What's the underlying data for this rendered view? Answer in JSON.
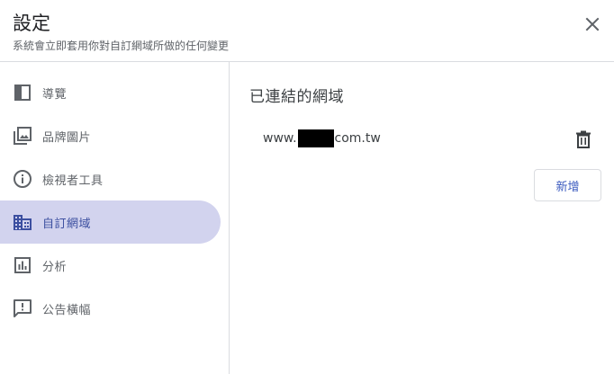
{
  "header": {
    "title": "設定",
    "subtitle": "系統會立即套用你對自訂網域所做的任何變更",
    "close_icon": "close-icon"
  },
  "sidebar": {
    "items": [
      {
        "label": "導覽",
        "icon": "layout-panel-icon",
        "active": false
      },
      {
        "label": "品牌圖片",
        "icon": "image-library-icon",
        "active": false
      },
      {
        "label": "檢視者工具",
        "icon": "info-icon",
        "active": false
      },
      {
        "label": "自訂網域",
        "icon": "domain-icon",
        "active": true
      },
      {
        "label": "分析",
        "icon": "analytics-icon",
        "active": false
      },
      {
        "label": "公告橫幅",
        "icon": "announcement-icon",
        "active": false
      }
    ]
  },
  "main": {
    "section_title": "已連結的網域",
    "domain_prefix": "www.",
    "domain_suffix": "com.tw",
    "add_label": "新增"
  },
  "colors": {
    "active_bg": "#d2d3ee",
    "active_text": "#3c4fa0",
    "accent": "#3c5bbf",
    "divider": "#dadce0"
  }
}
